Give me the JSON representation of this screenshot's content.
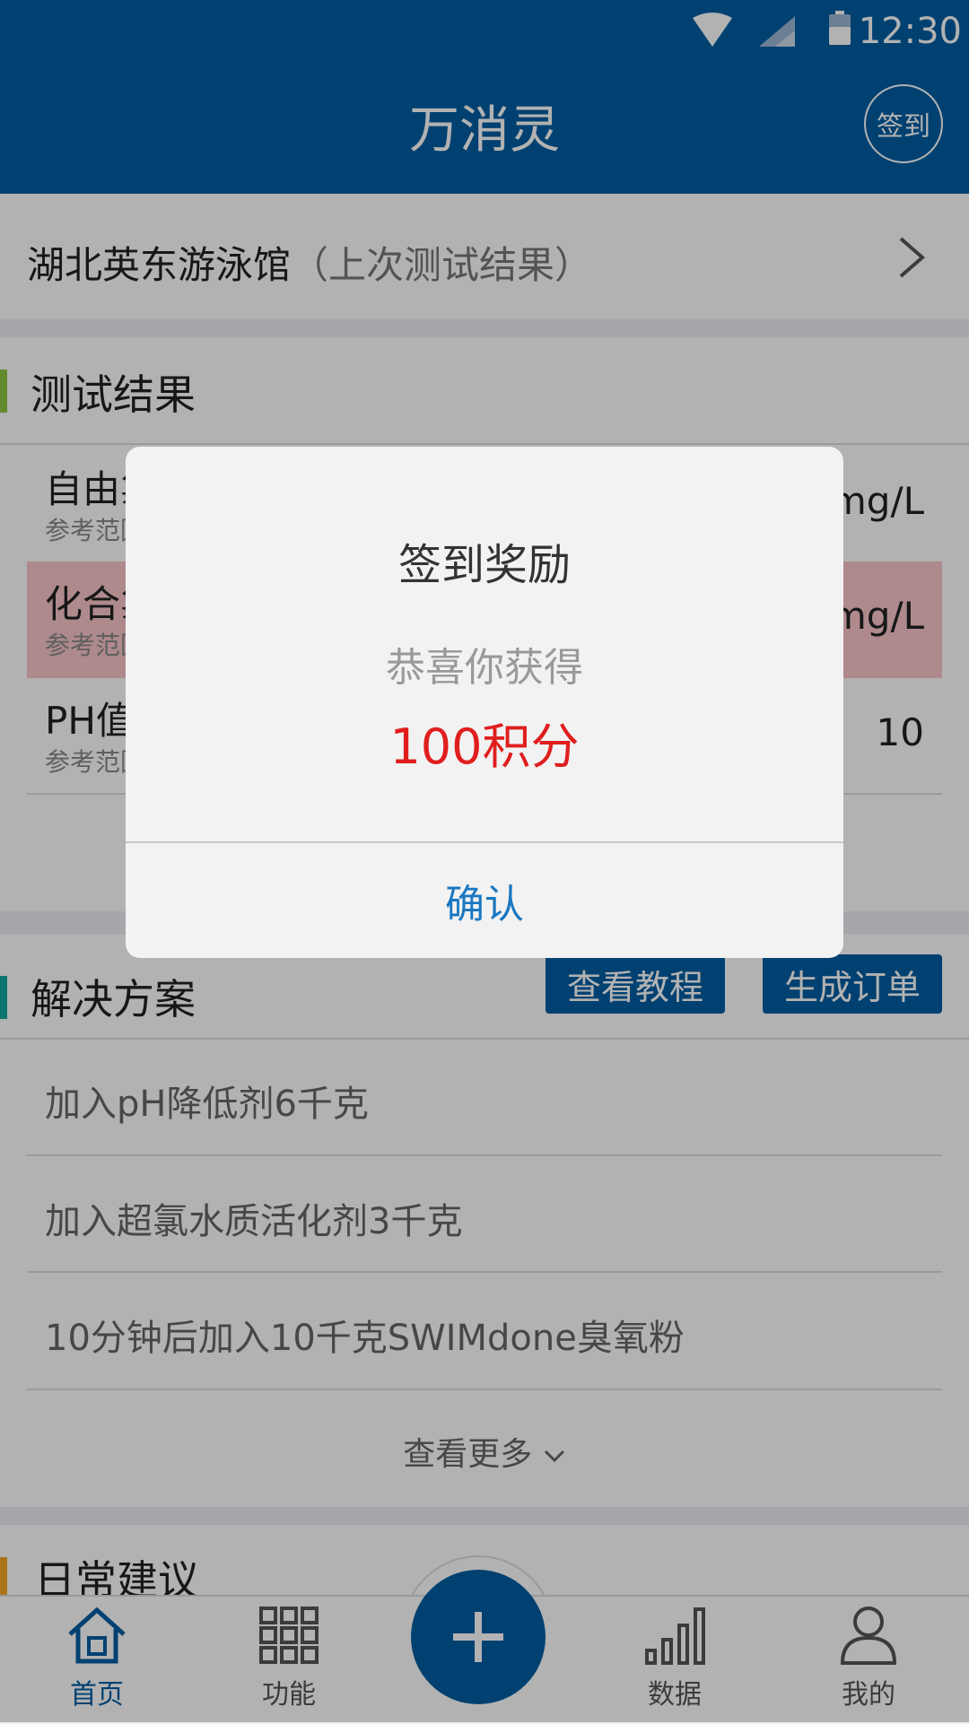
{
  "status": {
    "time": "12:30"
  },
  "header": {
    "title": "万消灵",
    "signin_label": "签到"
  },
  "pool": {
    "name": "湖北英东游泳馆",
    "note": "（上次测试结果）"
  },
  "results": {
    "title": "测试结果",
    "rows": [
      {
        "name": "自由氯",
        "ref": "参考范围",
        "value": "mg/L",
        "alert": false
      },
      {
        "name": "化合氯",
        "ref": "参考范围",
        "value": "mg/L",
        "alert": true
      },
      {
        "name": "PH值",
        "ref": "参考范围",
        "value": "10",
        "alert": false
      }
    ]
  },
  "solutions": {
    "title": "解决方案",
    "tutorial_label": "查看教程",
    "order_label": "生成订单",
    "items": [
      "加入pH降低剂6千克",
      "加入超氯水质活化剂3千克",
      "10分钟后加入10千克SWIMdone臭氧粉"
    ],
    "more_label": "查看更多"
  },
  "daily": {
    "title": "日常建议"
  },
  "nav": {
    "items": [
      {
        "label": "首页",
        "icon": "home-icon",
        "active": true
      },
      {
        "label": "功能",
        "icon": "grid-icon",
        "active": false
      },
      {
        "label": "数据",
        "icon": "chart-icon",
        "active": false
      },
      {
        "label": "我的",
        "icon": "user-icon",
        "active": false
      }
    ]
  },
  "dialog": {
    "title": "签到奖励",
    "subtitle": "恭喜你获得",
    "reward": "100积分",
    "confirm_label": "确认"
  },
  "colors": {
    "primary": "#015ea3",
    "alert_bg": "#f9c6c9",
    "reward": "#e01e1e",
    "link": "#1a78c2"
  }
}
